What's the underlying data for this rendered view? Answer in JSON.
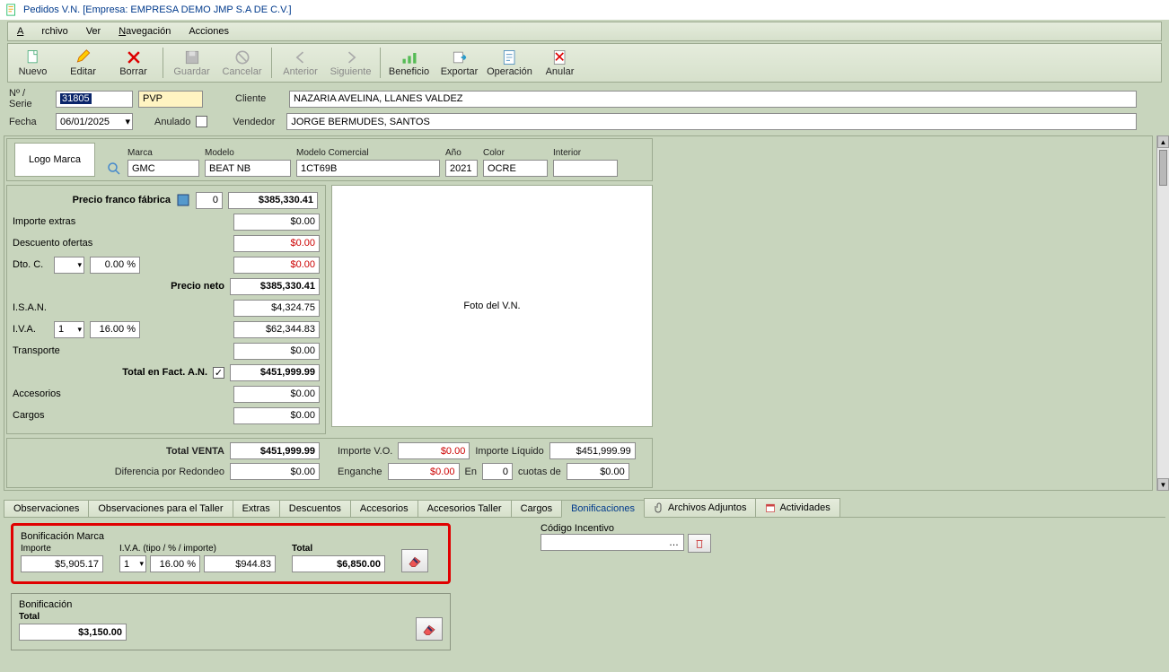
{
  "title": "Pedidos V.N. [Empresa: EMPRESA DEMO JMP S.A DE C.V.]",
  "menu": {
    "archivo": "Archivo",
    "ver": "Ver",
    "navegacion": "Navegación",
    "acciones": "Acciones"
  },
  "toolbar": {
    "nuevo": "Nuevo",
    "editar": "Editar",
    "borrar": "Borrar",
    "guardar": "Guardar",
    "cancelar": "Cancelar",
    "anterior": "Anterior",
    "siguiente": "Siguiente",
    "beneficio": "Beneficio",
    "exportar": "Exportar",
    "operacion": "Operación",
    "anular": "Anular"
  },
  "hdr": {
    "serie_label": "Nº / Serie",
    "serie": "31805",
    "pvp_label": "PVP",
    "pvp": "",
    "cliente_label": "Cliente",
    "cliente": "NAZARIA  AVELINA, LLANES VALDEZ",
    "fecha_label": "Fecha",
    "fecha": "06/01/2025",
    "anulado_label": "Anulado",
    "vendedor_label": "Vendedor",
    "vendedor": "JORGE BERMUDES, SANTOS"
  },
  "veh": {
    "logo": "Logo Marca",
    "marca_lbl": "Marca",
    "marca": "GMC",
    "modelo_lbl": "Modelo",
    "modelo": "BEAT NB",
    "mcom_lbl": "Modelo Comercial",
    "mcom": "1CT69B",
    "ano_lbl": "Año",
    "ano": "2021",
    "color_lbl": "Color",
    "color": "OCRE",
    "interior_lbl": "Interior",
    "interior": ""
  },
  "price": {
    "pff": "Precio franco fábrica",
    "pff_code": "0",
    "pff_val": "$385,330.41",
    "extras": "Importe extras",
    "extras_val": "$0.00",
    "desc": "Descuento ofertas",
    "desc_val": "$0.00",
    "dtoc": "Dto. C.",
    "dtoc_sel": "",
    "dtoc_pct": "0.00 %",
    "dtoc_val": "$0.00",
    "neto": "Precio neto",
    "neto_val": "$385,330.41",
    "isan": "I.S.A.N.",
    "isan_val": "$4,324.75",
    "iva": "I.V.A.",
    "iva_sel": "1",
    "iva_pct": "16.00 %",
    "iva_val": "$62,344.83",
    "trans": "Transporte",
    "trans_val": "$0.00",
    "tfan": "Total en Fact. A.N.",
    "tfan_val": "$451,999.99",
    "acc": "Accesorios",
    "acc_val": "$0.00",
    "cargos": "Cargos",
    "cargos_val": "$0.00"
  },
  "photo": "Foto del V.N.",
  "totals": {
    "tventa": "Total VENTA",
    "tventa_val": "$451,999.99",
    "difred": "Diferencia por Redondeo",
    "difred_val": "$0.00",
    "impvo": "Importe V.O.",
    "impvo_val": "$0.00",
    "impliq": "Importe Líquido",
    "impliq_val": "$451,999.99",
    "eng": "Enganche",
    "eng_val": "$0.00",
    "en": "En",
    "en_val": "0",
    "cuotas": "cuotas de",
    "cuotas_val": "$0.00"
  },
  "tabs": {
    "obs": "Observaciones",
    "obst": "Observaciones para el Taller",
    "extras": "Extras",
    "desc": "Descuentos",
    "acc": "Accesorios",
    "acct": "Accesorios Taller",
    "cargos": "Cargos",
    "bonif": "Bonificaciones",
    "adj": "Archivos Adjuntos",
    "act": "Actividades"
  },
  "bonif": {
    "marca_title": "Bonificación Marca",
    "importe_lbl": "Importe",
    "importe": "$5,905.17",
    "iva_lbl": "I.V.A. (tipo / % / importe)",
    "iva_sel": "1",
    "iva_pct": "16.00 %",
    "iva_imp": "$944.83",
    "total_lbl": "Total",
    "total": "$6,850.00",
    "cod_lbl": "Código Incentivo",
    "cod": "",
    "b2_title": "Bonificación",
    "b2_total_lbl": "Total",
    "b2_total": "$3,150.00"
  }
}
